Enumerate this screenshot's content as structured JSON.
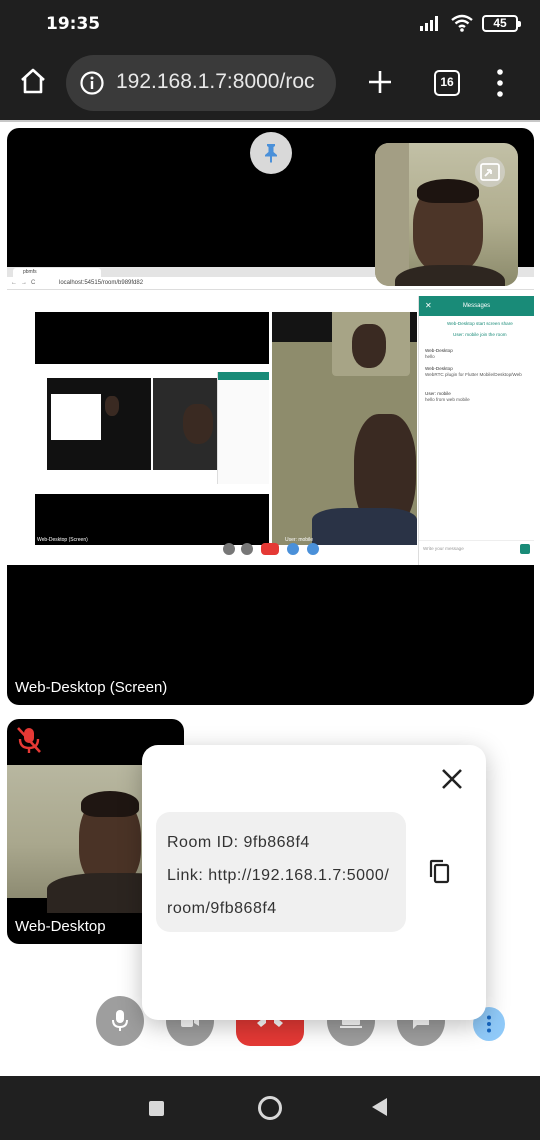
{
  "status_bar": {
    "time": "19:35",
    "battery": "45",
    "icons": [
      "signal-icon",
      "wifi-icon",
      "battery-icon"
    ]
  },
  "browser": {
    "url": "192.168.1.7:8000/roc",
    "tab_count": "16",
    "icons": [
      "home-icon",
      "info-icon",
      "new-tab-icon",
      "tabs-icon",
      "more-vert-icon"
    ]
  },
  "main_tile": {
    "label": "Web-Desktop (Screen)",
    "icons": [
      "pin-icon",
      "picture-in-picture-icon"
    ],
    "shared_screen": {
      "tab_title": "pbmfs",
      "address": "localhost:54515/room/b989fd82",
      "messages_title": "Messages",
      "system_lines": [
        "Web-Desktop start screen share",
        "User: mobile join the room"
      ],
      "messages": [
        {
          "sender": "Web-Desktop",
          "text": "hello"
        },
        {
          "sender": "Web-Desktop",
          "text": "WebRTC plugin for Flutter Mobile/Desktop/Web"
        },
        {
          "sender": "User: mobile",
          "text": "hello from web mobile"
        }
      ],
      "input_placeholder": "Write your message",
      "caption_left": "Web-Desktop (Screen)",
      "caption_right": "User: mobile"
    }
  },
  "small_tile": {
    "label": "Web-Desktop",
    "icons": [
      "mic-off-icon"
    ]
  },
  "dialog": {
    "room_id": "Room  ID:  9fb868f4",
    "link_line1": "Link:  http://192.168.1.7:5000/",
    "link_line2": "room/9fb868f4",
    "icons": [
      "close-icon",
      "copy-icon"
    ]
  },
  "controls": {
    "icons": [
      "mic-icon",
      "video-icon",
      "call-end-icon",
      "screen-share-icon",
      "chat-icon",
      "more-vert-icon"
    ]
  },
  "nav_bar": {
    "icons": [
      "recents-icon",
      "home-icon",
      "back-icon"
    ]
  },
  "colors": {
    "teal": "#198b78",
    "end_call": "#e53935",
    "more_accent": "#90caf9",
    "dark_bar": "#1f1f1f"
  }
}
